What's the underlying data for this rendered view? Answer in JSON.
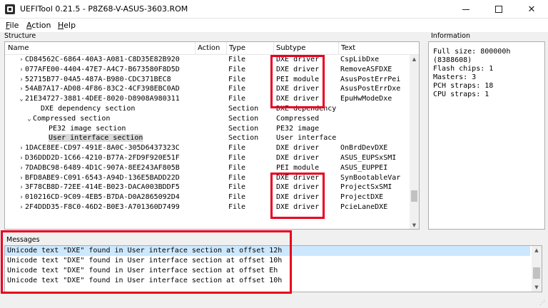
{
  "window": {
    "title": "UEFITool 0.21.5 - P8Z68-V-ASUS-3603.ROM"
  },
  "menu": {
    "file": {
      "accel": "F",
      "rest": "ile"
    },
    "action": {
      "accel": "A",
      "rest": "ction"
    },
    "help": {
      "accel": "H",
      "rest": "elp"
    }
  },
  "structure": {
    "label": "Structure",
    "columns": [
      "Name",
      "Action",
      "Type",
      "Subtype",
      "Text"
    ],
    "rows": [
      {
        "twist": "›",
        "indent": 2,
        "name": "CD84562C-6864-40A3-A081-C8D35E82B920",
        "action": "",
        "type": "File",
        "subtype": "DXE driver",
        "text": "CspLibDxe"
      },
      {
        "twist": "›",
        "indent": 2,
        "name": "077AFE00-4404-47E7-A4C7-B673580F8D5D",
        "action": "",
        "type": "File",
        "subtype": "DXE driver",
        "text": "RemoveASFDXE"
      },
      {
        "twist": "›",
        "indent": 2,
        "name": "52715B77-04A5-487A-B980-CDC371BEC8",
        "action": "",
        "type": "File",
        "subtype": "PEI module",
        "text": "AsusPostErrPei"
      },
      {
        "twist": "›",
        "indent": 2,
        "name": "54AB7A17-AD08-4F86-83C2-4CF398EBC0AD",
        "action": "",
        "type": "File",
        "subtype": "DXE driver",
        "text": "AsusPostErrDxe"
      },
      {
        "twist": "⌄",
        "indent": 2,
        "name": "21E34727-3881-4DEE-8020-D8908A980311",
        "action": "",
        "type": "File",
        "subtype": "DXE driver",
        "text": "EpuHwModeDxe"
      },
      {
        "twist": "",
        "indent": 4,
        "name": "DXE dependency section",
        "action": "",
        "type": "Section",
        "subtype": "DXE dependency",
        "text": ""
      },
      {
        "twist": "⌄",
        "indent": 3,
        "name": "Compressed section",
        "action": "",
        "type": "Section",
        "subtype": "Compressed",
        "text": ""
      },
      {
        "twist": "",
        "indent": 5,
        "name": "PE32 image section",
        "action": "",
        "type": "Section",
        "subtype": "PE32 image",
        "text": ""
      },
      {
        "twist": "",
        "indent": 5,
        "name": "User interface section",
        "action": "",
        "type": "Section",
        "subtype": "User interface",
        "text": "",
        "highlight": true
      },
      {
        "twist": "›",
        "indent": 2,
        "name": "1DACE8EE-CD97-491E-8A0C-305D6437323C",
        "action": "",
        "type": "File",
        "subtype": "DXE driver",
        "text": "OnBrdDevDXE"
      },
      {
        "twist": "›",
        "indent": 2,
        "name": "D36DDD2D-1C66-4210-B77A-2FD9F920E51F",
        "action": "",
        "type": "File",
        "subtype": "DXE driver",
        "text": "ASUS_EUPSxSMI"
      },
      {
        "twist": "›",
        "indent": 2,
        "name": "7DADBC98-6489-4D1C-907A-8EE243AF805B",
        "action": "",
        "type": "File",
        "subtype": "PEI module",
        "text": "ASUS_EUPPEI"
      },
      {
        "twist": "›",
        "indent": 2,
        "name": "BFD8ABE9-C091-6543-A94D-136E5BADD22D",
        "action": "",
        "type": "File",
        "subtype": "DXE driver",
        "text": "SynBootableVar"
      },
      {
        "twist": "›",
        "indent": 2,
        "name": "3F78CB8D-72EE-414E-B023-DACA003BDDF5",
        "action": "",
        "type": "File",
        "subtype": "DXE driver",
        "text": "ProjectSxSMI"
      },
      {
        "twist": "›",
        "indent": 2,
        "name": "010216CD-9C09-4EB5-B7DA-D0A2865092D4",
        "action": "",
        "type": "File",
        "subtype": "DXE driver",
        "text": "ProjectDXE"
      },
      {
        "twist": "›",
        "indent": 2,
        "name": "2F4DDD35-F8C0-46D2-B0E3-A701360D7499",
        "action": "",
        "type": "File",
        "subtype": "DXE driver",
        "text": "PcieLaneDXE"
      }
    ]
  },
  "information": {
    "label": "Information",
    "text": "Full size: 800000h\n(8388608)\nFlash chips: 1\nMasters: 3\nPCH straps: 18\nCPU straps: 1"
  },
  "messages": {
    "label": "Messages",
    "items": [
      "Unicode text \"DXE\" found in User interface section at offset 12h",
      "Unicode text \"DXE\" found in User interface section at offset 10h",
      "Unicode text \"DXE\" found in User interface section at offset Eh",
      "Unicode text \"DXE\" found in User interface section at offset 10h"
    ]
  },
  "colors": {
    "annotation": "#e8001c",
    "selection": "#cce8ff"
  }
}
